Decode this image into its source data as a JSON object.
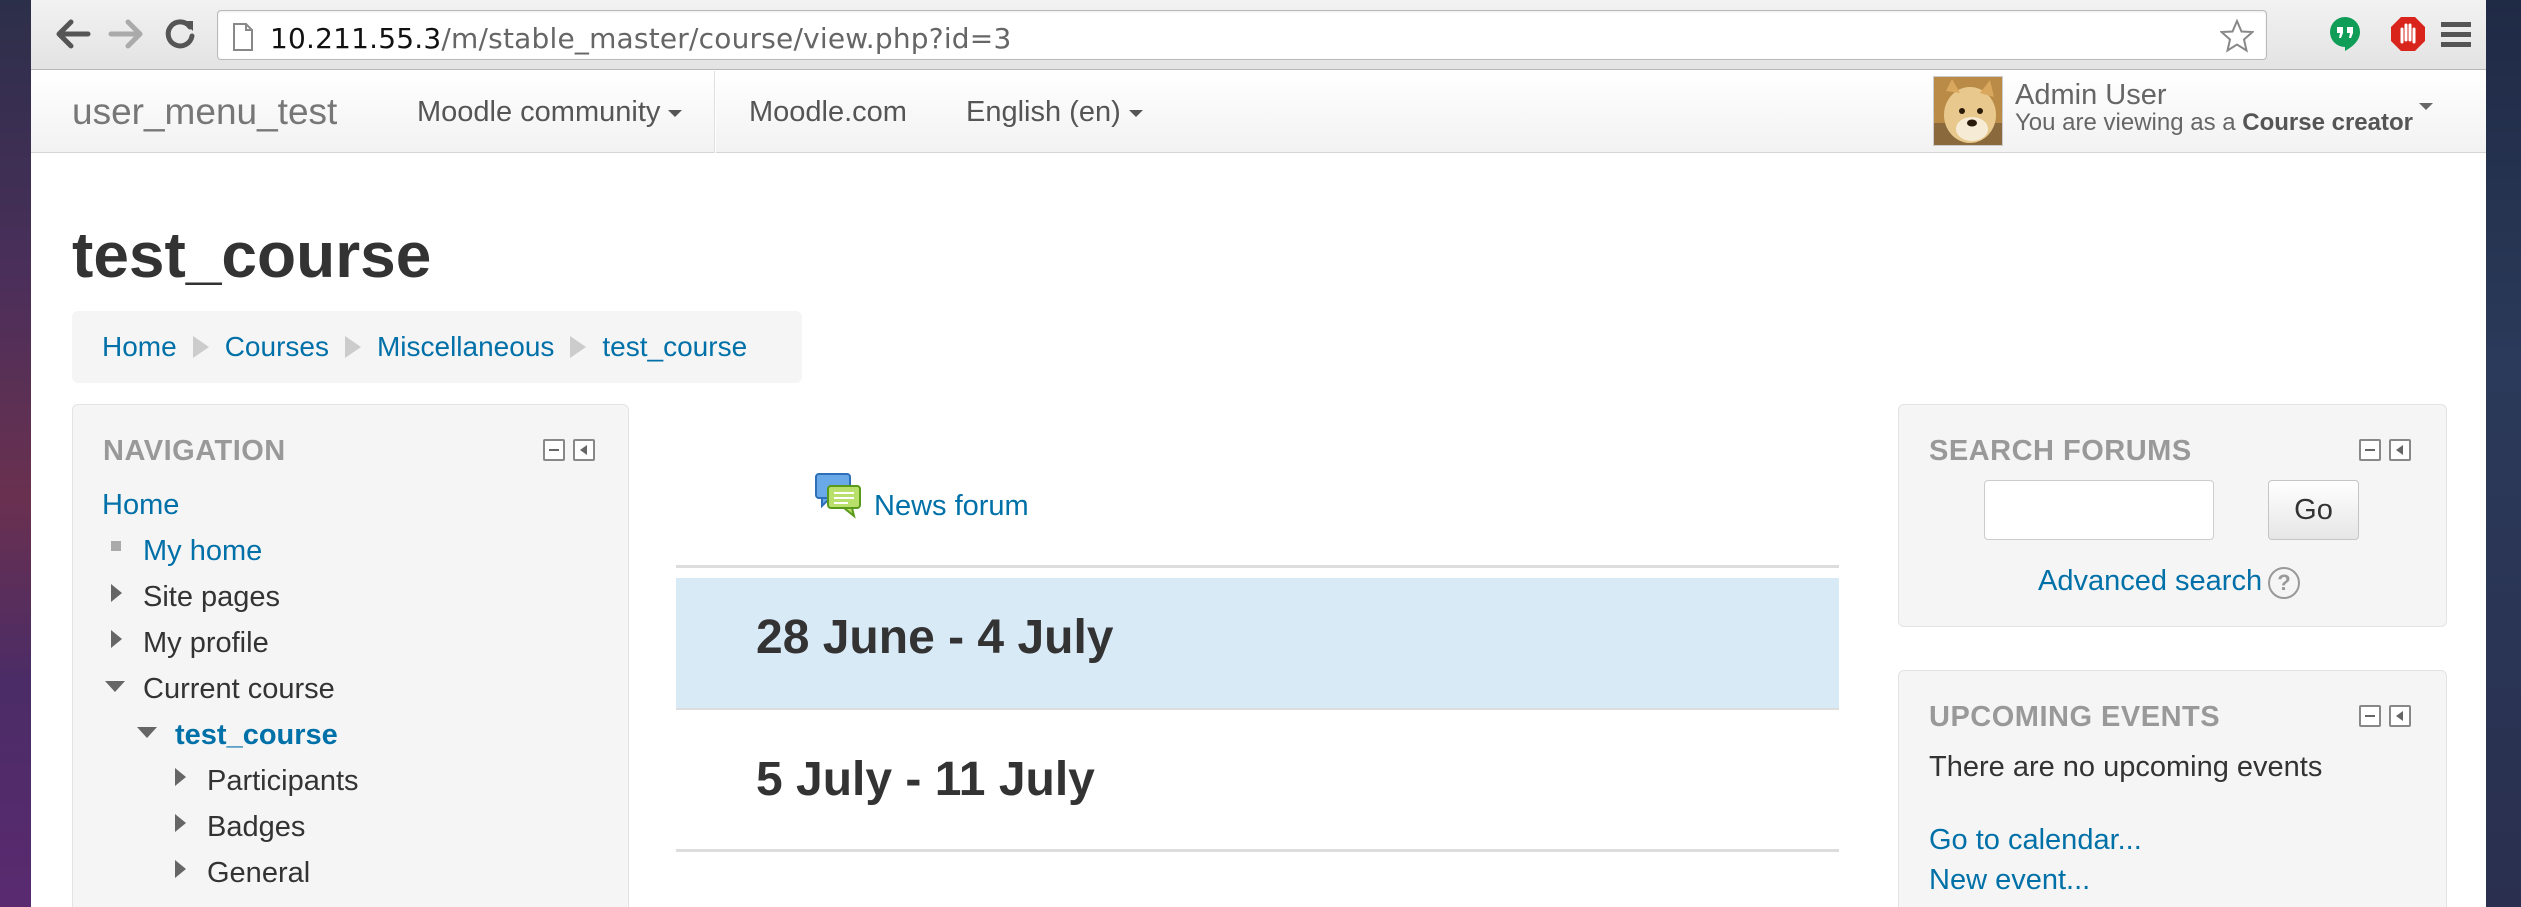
{
  "browser": {
    "url_host": "10.211.55.3",
    "url_path": "/m/stable_master/course/view.php?id=3",
    "back_icon": "arrow-left-icon",
    "forward_icon": "arrow-right-icon",
    "reload_icon": "reload-icon",
    "star_icon": "star-icon",
    "menu_icon": "hamburger-menu-icon"
  },
  "navbar": {
    "brand": "user_menu_test",
    "menu": [
      "Moodle community",
      "Moodle.com",
      "English (en)"
    ],
    "user": {
      "name": "Admin User",
      "role_prefix": "You are viewing as a ",
      "role": "Course creator"
    }
  },
  "page": {
    "title": "test_course",
    "breadcrumb": [
      "Home",
      "Courses",
      "Miscellaneous",
      "test_course"
    ]
  },
  "navigation_block": {
    "title": "NAVIGATION",
    "items": [
      {
        "label": "Home",
        "link": true
      },
      {
        "label": "My home",
        "link": true
      },
      {
        "label": "Site pages",
        "link": false
      },
      {
        "label": "My profile",
        "link": false
      },
      {
        "label": "Current course",
        "link": false
      },
      {
        "label": "test_course",
        "link": true
      },
      {
        "label": "Participants",
        "link": false
      },
      {
        "label": "Badges",
        "link": false
      },
      {
        "label": "General",
        "link": false
      }
    ]
  },
  "course": {
    "forum_link": "News forum",
    "sections": [
      "28 June - 4 July",
      "5 July - 11 July"
    ]
  },
  "search_block": {
    "title": "SEARCH FORUMS",
    "button": "Go",
    "advanced": "Advanced search"
  },
  "events_block": {
    "title": "UPCOMING EVENTS",
    "empty": "There are no upcoming events",
    "calendar_link": "Go to calendar...",
    "new_event_link": "New event..."
  },
  "colors": {
    "link": "#0070a8",
    "current_section": "#d9eaf7"
  }
}
